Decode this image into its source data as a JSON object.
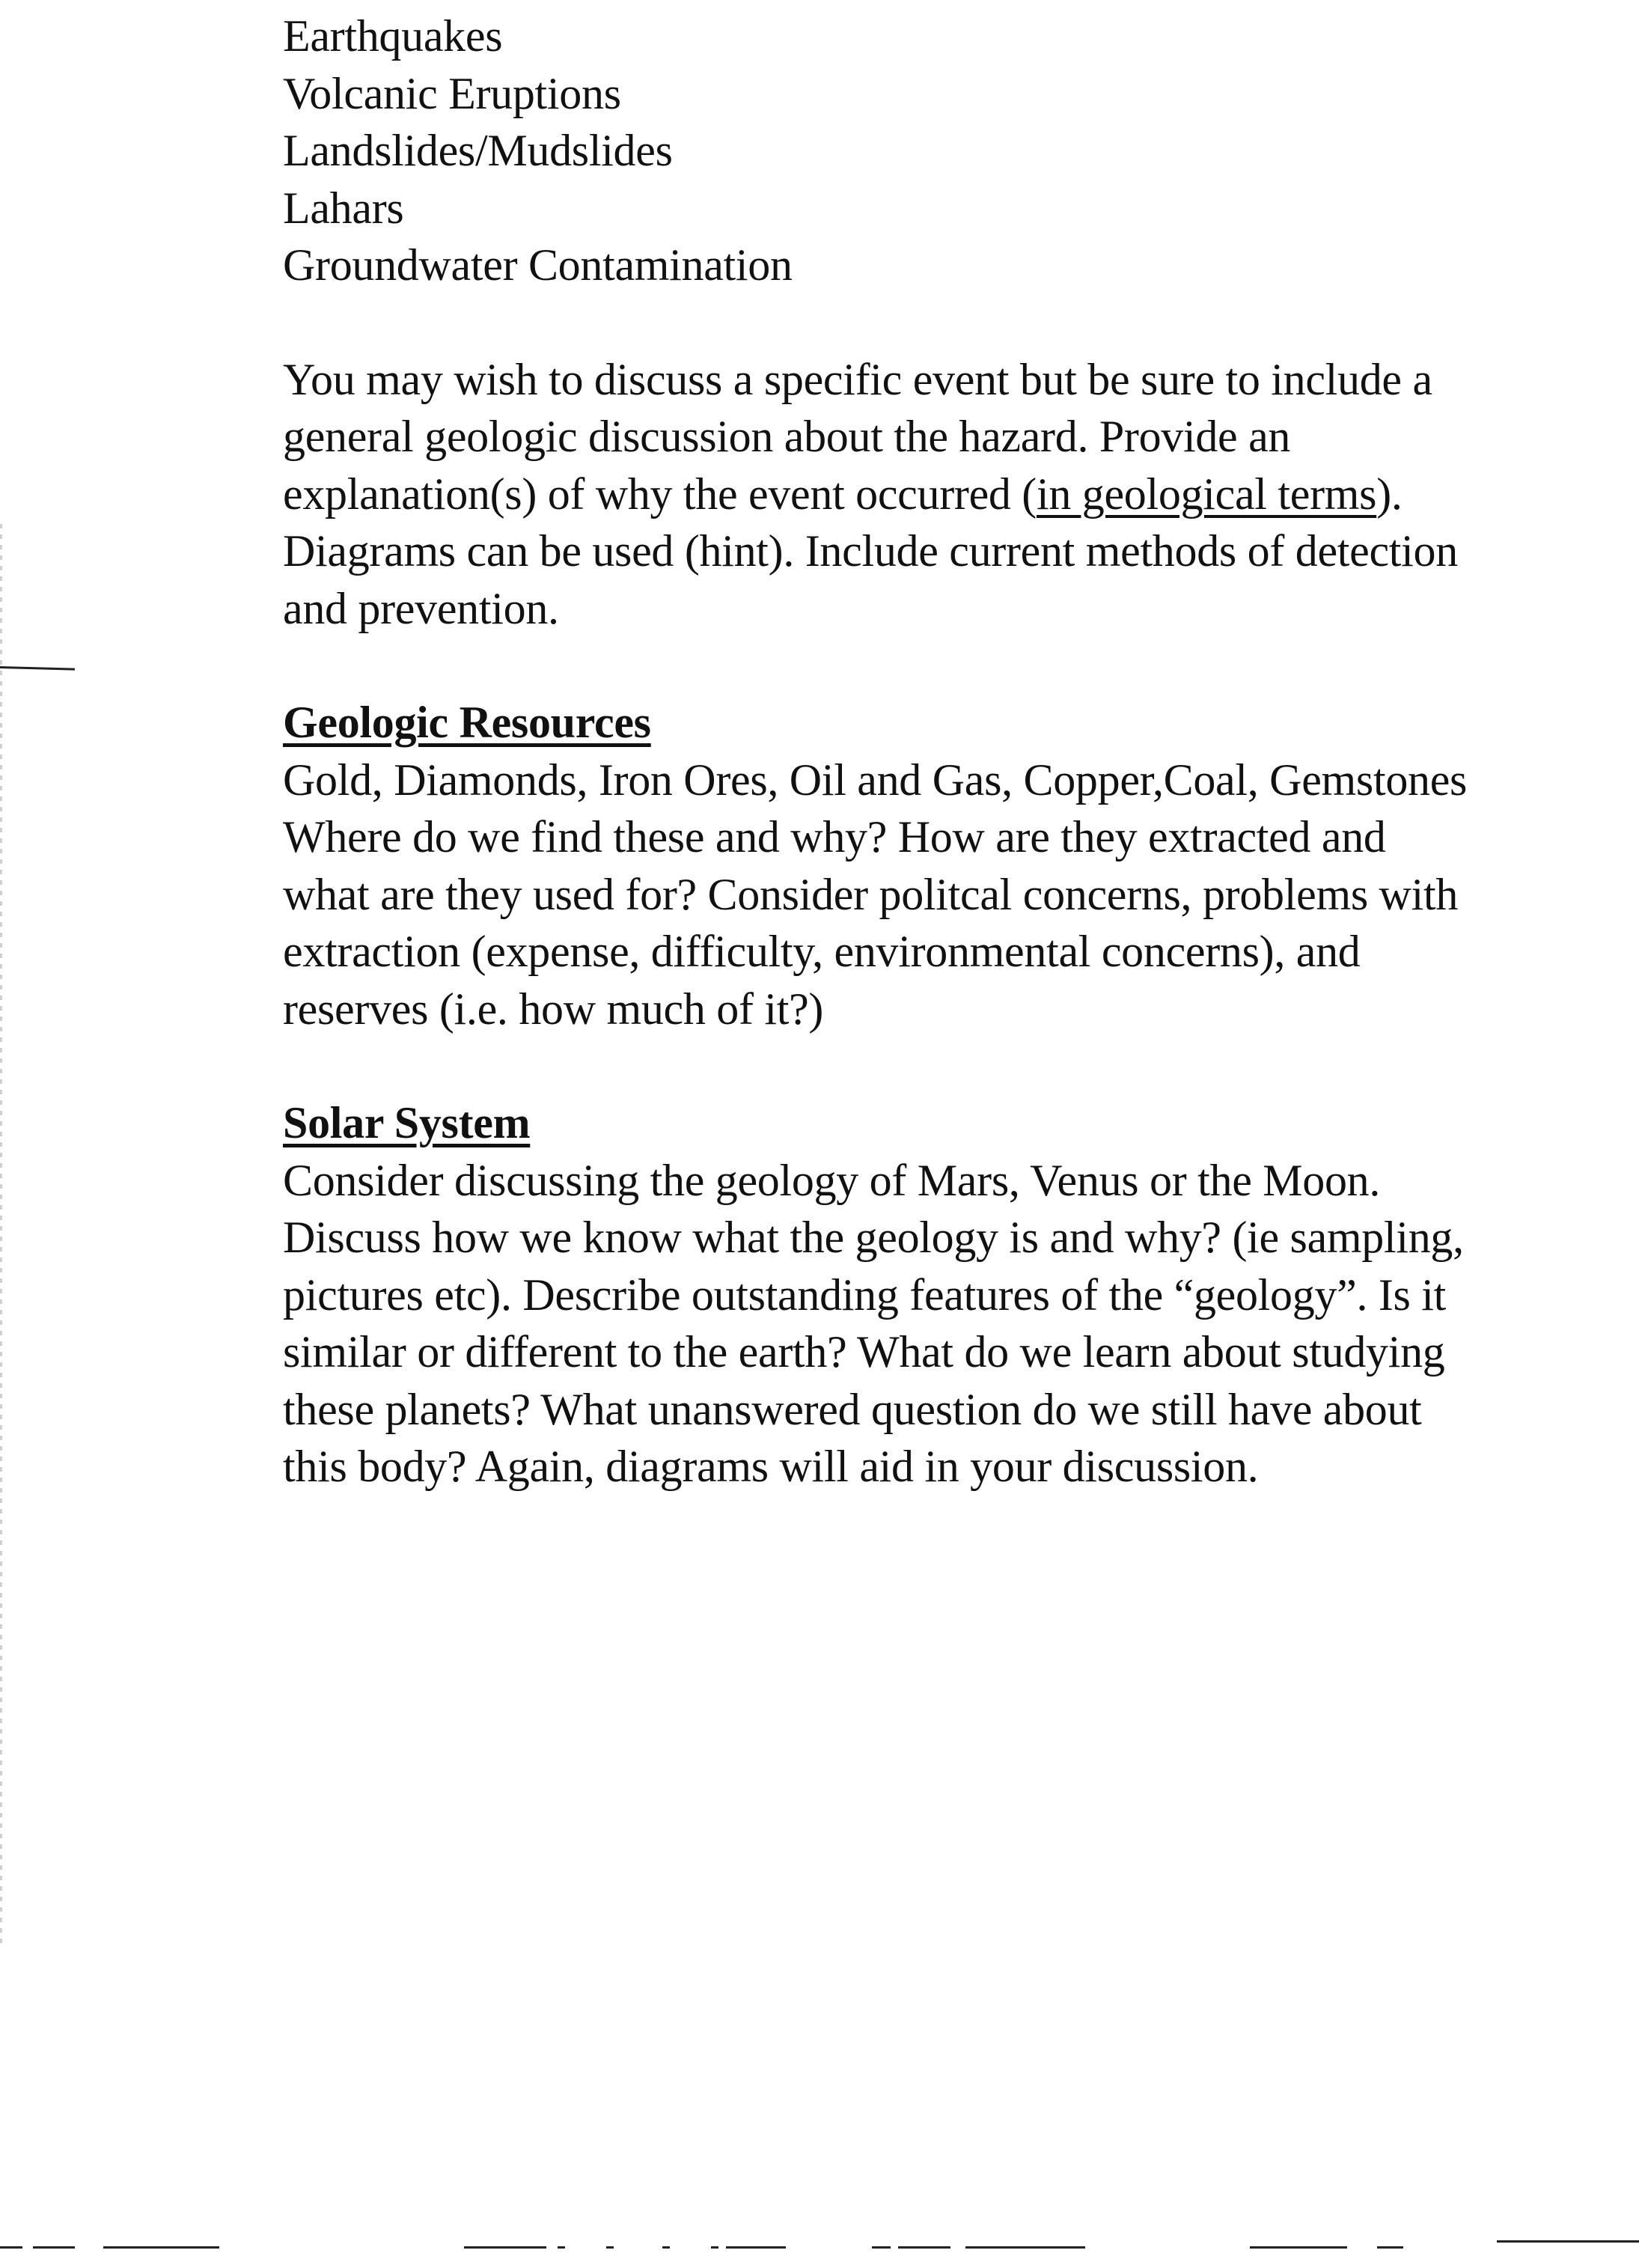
{
  "hazards_list": [
    "Earthquakes",
    "Volcanic Eruptions",
    "Landslides/Mudslides",
    "Lahars",
    "Groundwater Contamination"
  ],
  "hazards_paragraph": {
    "line1": "You may wish to discuss a specific event but be sure to include a",
    "line2": "general geologic discussion about the hazard.  Provide an",
    "line3_pre": "explanation(s) of why the event occurred (",
    "line3_underlined": "in geological terms",
    "line3_post": ").",
    "line4": "Diagrams can be used (hint).  Include current methods of detection",
    "line5": "and prevention."
  },
  "geologic_resources": {
    "heading": "Geologic Resources",
    "lines": [
      "Gold, Diamonds, Iron Ores, Oil and Gas, Copper,Coal, Gemstones",
      "Where do we find these and why?  How are they extracted and",
      "what are they used for?  Consider politcal concerns, problems with",
      "extraction (expense, difficulty, environmental concerns), and",
      "reserves (i.e. how much of it?)"
    ]
  },
  "solar_system": {
    "heading": "Solar System",
    "lines": [
      "Consider discussing the geology of Mars, Venus or the Moon.",
      "Discuss how we know what the geology is and why? (ie sampling,",
      "pictures etc).  Describe outstanding features of the “geology”.  Is it",
      "similar or different to the earth?  What do we learn about studying",
      "these planets?  What unanswered question do we still have about",
      "this body?  Again, diagrams will aid in your discussion."
    ]
  }
}
